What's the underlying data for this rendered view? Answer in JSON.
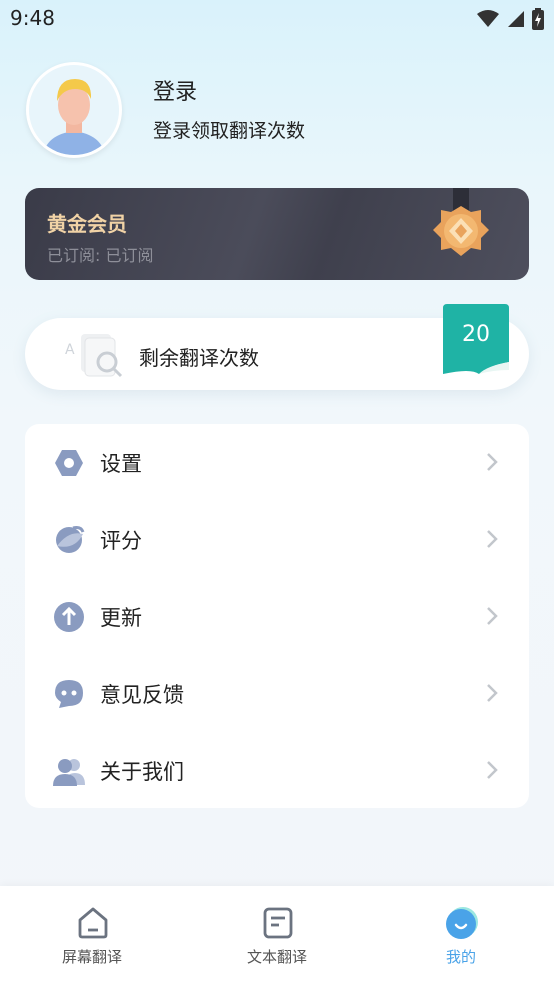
{
  "status_bar": {
    "time": "9:48"
  },
  "profile": {
    "login_title": "登录",
    "login_subtitle": "登录领取翻译次数"
  },
  "vip": {
    "title": "黄金会员",
    "subtitle": "已订阅: 已订阅"
  },
  "quota": {
    "label": "剩余翻译次数",
    "count": "20"
  },
  "menu": {
    "items": [
      {
        "label": "设置",
        "icon": "settings-icon"
      },
      {
        "label": "评分",
        "icon": "rating-icon"
      },
      {
        "label": "更新",
        "icon": "update-icon"
      },
      {
        "label": "意见反馈",
        "icon": "feedback-icon"
      },
      {
        "label": "关于我们",
        "icon": "about-icon"
      }
    ]
  },
  "bottom_nav": {
    "items": [
      {
        "label": "屏幕翻译",
        "icon": "home-icon"
      },
      {
        "label": "文本翻译",
        "icon": "document-icon"
      },
      {
        "label": "我的",
        "icon": "profile-icon"
      }
    ],
    "active": "我的"
  },
  "colors": {
    "accent": "#4aa3e8",
    "vip_gold": "#f1d3a6",
    "quota_badge": "#1fb3a5",
    "menu_icon": "#8a9bc0"
  }
}
